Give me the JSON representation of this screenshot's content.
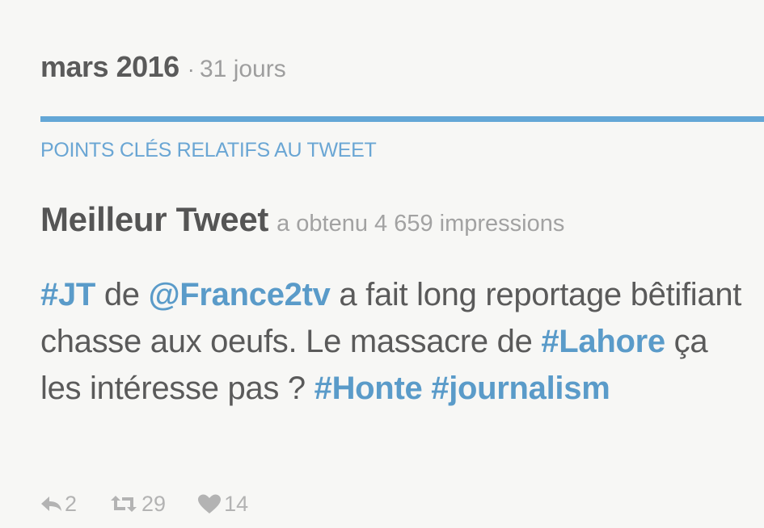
{
  "period": {
    "month": "mars 2016",
    "separator": "·",
    "days": "31 jours"
  },
  "section": {
    "title": "POINTS CLÉS RELATIFS AU TWEET"
  },
  "top_tweet": {
    "heading": "Meilleur Tweet",
    "impressions_text": "a obtenu 4 659 impressions",
    "text_segments": [
      {
        "text": "#JT",
        "type": "hashtag"
      },
      {
        "text": " de ",
        "type": "plain"
      },
      {
        "text": "@France2tv",
        "type": "mention"
      },
      {
        "text": " a fait long reportage bêtifiant chasse aux oeufs. Le massacre de ",
        "type": "plain"
      },
      {
        "text": "#Lahore",
        "type": "hashtag"
      },
      {
        "text": " ça les intéresse pas ? ",
        "type": "plain"
      },
      {
        "text": "#Honte",
        "type": "hashtag"
      },
      {
        "text": " ",
        "type": "plain"
      },
      {
        "text": "#journalism",
        "type": "hashtag"
      }
    ]
  },
  "actions": {
    "reply": {
      "icon": "reply-icon",
      "count": "2"
    },
    "retweet": {
      "icon": "retweet-icon",
      "count": "29"
    },
    "like": {
      "icon": "heart-icon",
      "count": "14"
    }
  },
  "colors": {
    "accent": "#64a7d6",
    "link": "#5a9bc9",
    "text": "#555555",
    "muted": "#a2a2a2",
    "icon": "#b3b3b3"
  }
}
